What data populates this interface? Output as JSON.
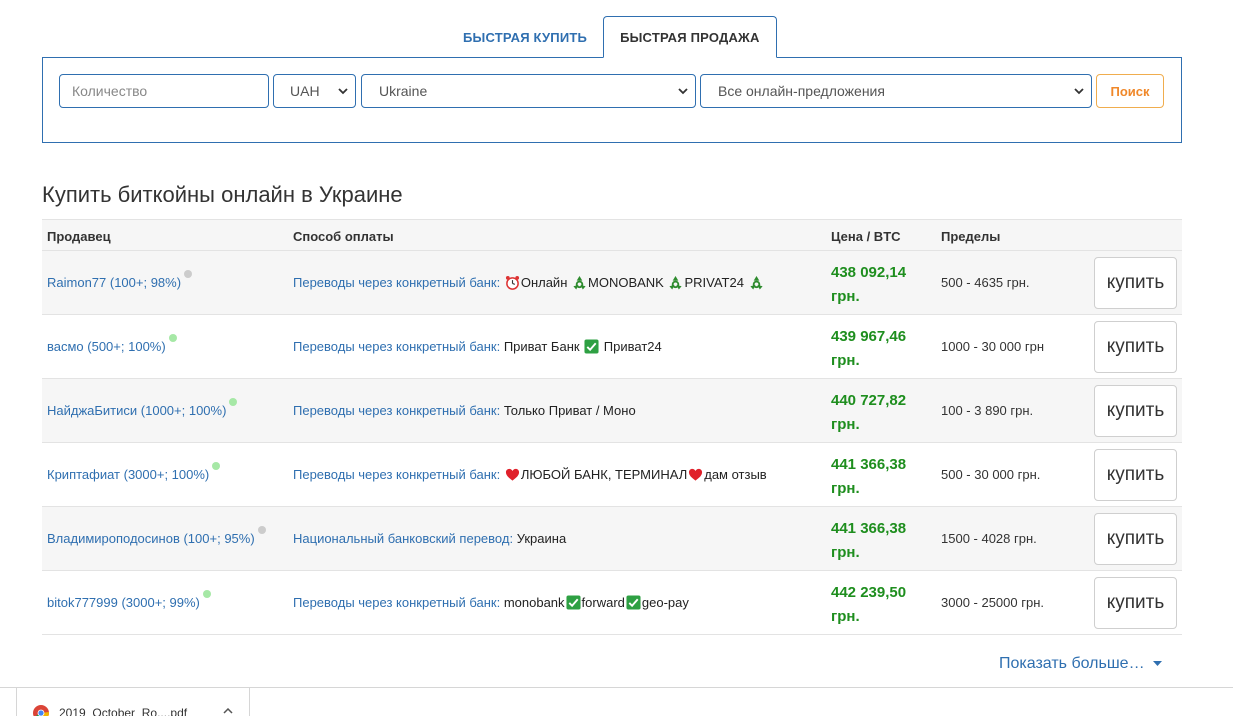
{
  "tabs": {
    "buy_label": "БЫСТРАЯ КУПИТЬ",
    "sell_label": "БЫСТРАЯ ПРОДАЖА"
  },
  "search": {
    "quantity_placeholder": "Количество",
    "currency_value": "UAH",
    "country_value": "Ukraine",
    "offers_value": "Все онлайн-предложения",
    "search_label": "Поиск"
  },
  "page_title": "Купить биткойны онлайн в Украине",
  "table": {
    "headers": {
      "seller": "Продавец",
      "payment": "Способ оплаты",
      "price": "Цена / BTC",
      "limits": "Пределы"
    },
    "rows": [
      {
        "seller": "Raimon77 (100+; 98%)",
        "status_color": "#cccccc",
        "payment_type": "Переводы через конкретный банк:",
        "payment_parts": [
          {
            "icon": "alarm-clock-icon"
          },
          {
            "text": "Онлайн "
          },
          {
            "icon": "recycle-icon"
          },
          {
            "text": "MONOBANK "
          },
          {
            "icon": "recycle-icon"
          },
          {
            "text": "PRIVAT24 "
          },
          {
            "icon": "recycle-icon"
          }
        ],
        "price_amount": "438 092,14",
        "price_currency": "грн.",
        "limits": "500 - 4635 грн.",
        "buy_label": "купить"
      },
      {
        "seller": "васмо (500+; 100%)",
        "status_color": "#a6e8a6",
        "payment_type": "Переводы через конкретный банк:",
        "payment_parts": [
          {
            "text": "Приват Банк "
          },
          {
            "icon": "check-mark-icon"
          },
          {
            "text": " Приват24"
          }
        ],
        "price_amount": "439 967,46",
        "price_currency": "грн.",
        "limits": "1000 - 30 000 грн",
        "buy_label": "купить"
      },
      {
        "seller": "НайджаБитиси (1000+; 100%)",
        "status_color": "#a6e8a6",
        "payment_type": "Переводы через конкретный банк:",
        "payment_parts": [
          {
            "text": "Только Приват / Моно"
          }
        ],
        "price_amount": "440 727,82",
        "price_currency": "грн.",
        "limits": "100 - 3 890 грн.",
        "buy_label": "купить"
      },
      {
        "seller": "Криптафиат (3000+; 100%)",
        "status_color": "#a6e8a6",
        "payment_type": "Переводы через конкретный банк:",
        "payment_parts": [
          {
            "icon": "heart-icon"
          },
          {
            "text": "ЛЮБОЙ БАНК, ТЕРМИНАЛ"
          },
          {
            "icon": "heart-icon"
          },
          {
            "text": "дам отзыв"
          }
        ],
        "price_amount": "441 366,38",
        "price_currency": "грн.",
        "limits": "500 - 30 000 грн.",
        "buy_label": "купить"
      },
      {
        "seller": "Владимироподосинов (100+; 95%)",
        "status_color": "#cccccc",
        "payment_type": "Национальный банковский перевод:",
        "payment_parts": [
          {
            "text": "Украина"
          }
        ],
        "price_amount": "441 366,38",
        "price_currency": "грн.",
        "limits": "1500 - 4028 грн.",
        "buy_label": "купить"
      },
      {
        "seller": "bitok777999 (3000+; 99%)",
        "status_color": "#a6e8a6",
        "payment_type": "Переводы через конкретный банк:",
        "payment_parts": [
          {
            "text": "monobank"
          },
          {
            "icon": "check-mark-icon"
          },
          {
            "text": "forward"
          },
          {
            "icon": "check-mark-icon"
          },
          {
            "text": "geo-pay"
          }
        ],
        "price_amount": "442 239,50",
        "price_currency": "грн.",
        "limits": "3000 - 25000 грн.",
        "buy_label": "купить"
      }
    ]
  },
  "show_more_label": "Показать больше…",
  "download": {
    "file_name": "2019_October_Ro....pdf",
    "icon": "chrome-icon"
  }
}
